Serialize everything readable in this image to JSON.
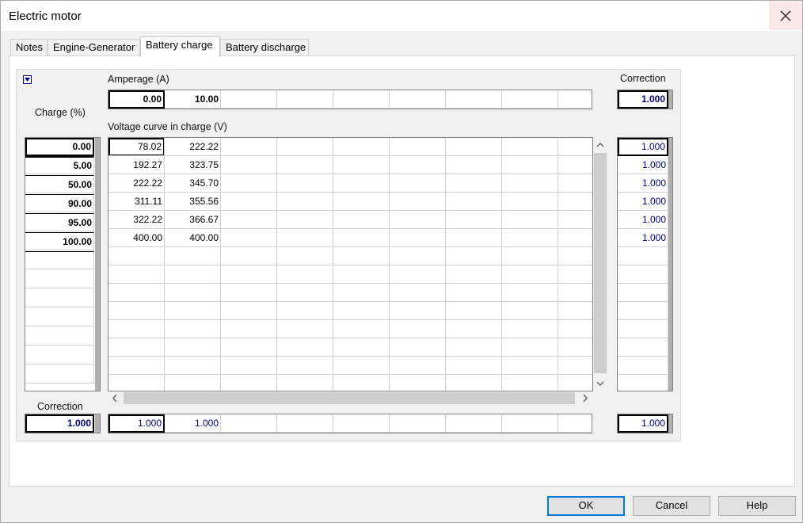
{
  "window": {
    "title": "Electric motor"
  },
  "tabs": [
    "Notes",
    "Engine-Generator",
    "Battery charge",
    "Battery discharge"
  ],
  "labels": {
    "amperage": "Amperage (A)",
    "charge": "Charge (%)",
    "voltage_curve": "Voltage curve in charge (V)",
    "correction_top": "Correction",
    "correction_bottom": "Correction"
  },
  "amperage": [
    "0.00",
    "10.00"
  ],
  "amperage_correction": "1.000",
  "charge_rows": [
    "0.00",
    "5.00",
    "50.00",
    "90.00",
    "95.00",
    "100.00"
  ],
  "voltage_rows": [
    [
      "78.02",
      "222.22"
    ],
    [
      "192.27",
      "323.75"
    ],
    [
      "222.22",
      "345.70"
    ],
    [
      "311.11",
      "355.56"
    ],
    [
      "322.22",
      "366.67"
    ],
    [
      "400.00",
      "400.00"
    ]
  ],
  "row_corrections": [
    "1.000",
    "1.000",
    "1.000",
    "1.000",
    "1.000",
    "1.000"
  ],
  "charge_correction": "1.000",
  "column_corrections": [
    "1.000",
    "1.000"
  ],
  "global_correction": "1.000",
  "buttons": {
    "ok": "OK",
    "cancel": "Cancel",
    "help": "Help"
  }
}
